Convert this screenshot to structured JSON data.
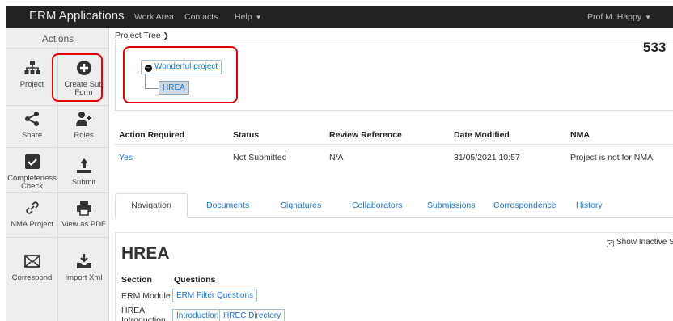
{
  "navbar": {
    "brand": "ERM Applications",
    "links": [
      "Work Area",
      "Contacts",
      "Help"
    ],
    "user": "Prof M. Happy"
  },
  "sidebar": {
    "title": "Actions",
    "actions": [
      {
        "label": "Project",
        "icon": "sitemap-icon"
      },
      {
        "label": "Create Sub Form",
        "icon": "plus-circle-icon"
      },
      {
        "label": "Share",
        "icon": "share-icon"
      },
      {
        "label": "Roles",
        "icon": "user-plus-icon"
      },
      {
        "label": "Completeness Check",
        "icon": "check-square-icon"
      },
      {
        "label": "Submit",
        "icon": "upload-icon"
      },
      {
        "label": "NMA Project",
        "icon": "link-icon"
      },
      {
        "label": "View as PDF",
        "icon": "print-icon"
      },
      {
        "label": "Correspond",
        "icon": "envelope-icon"
      },
      {
        "label": "Import Xml",
        "icon": "import-icon"
      }
    ]
  },
  "project_tree": {
    "label": "Project Tree",
    "root": "Wonderful project",
    "child": "HREA",
    "project_number": "533"
  },
  "status_table": {
    "headers": [
      "Action Required",
      "Status",
      "Review Reference",
      "Date Modified",
      "NMA"
    ],
    "row": [
      "Yes",
      "Not Submitted",
      "N/A",
      "31/05/2021 10:57",
      "Project is not for NMA"
    ]
  },
  "tabs": [
    "Navigation",
    "Documents",
    "Signatures",
    "Collaborators",
    "Submissions",
    "Correspondence",
    "History"
  ],
  "form": {
    "title": "HREA",
    "show_inactive": "Show Inactive S",
    "section_header": "Section",
    "questions_header": "Questions",
    "sections": [
      {
        "name": "ERM Module",
        "questions": [
          "ERM Filter Questions"
        ]
      },
      {
        "name": "HREA Introduction",
        "questions": [
          "Introduction",
          "HREC Directory"
        ]
      }
    ]
  },
  "colors": {
    "highlight": "#e00000",
    "link": "#1a73c7",
    "navbar": "#222222"
  }
}
